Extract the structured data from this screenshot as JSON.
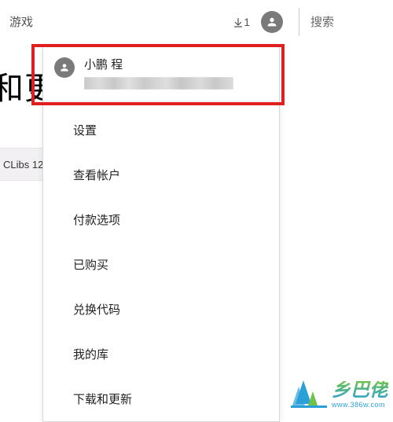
{
  "topbar": {
    "tab_label": "游戏",
    "download_count": "1",
    "search_placeholder": "搜索"
  },
  "background": {
    "partial_heading": "和更",
    "partial_item": "CLibs 12"
  },
  "account": {
    "name": "小鹏 程"
  },
  "menu": {
    "items": [
      {
        "label": "设置"
      },
      {
        "label": "查看帐户"
      },
      {
        "label": "付款选项"
      },
      {
        "label": "已购买"
      },
      {
        "label": "兑换代码"
      },
      {
        "label": "我的库"
      },
      {
        "label": "下载和更新"
      }
    ]
  },
  "watermark": {
    "brand": "乡巴佬",
    "url": "www.386w.com"
  }
}
